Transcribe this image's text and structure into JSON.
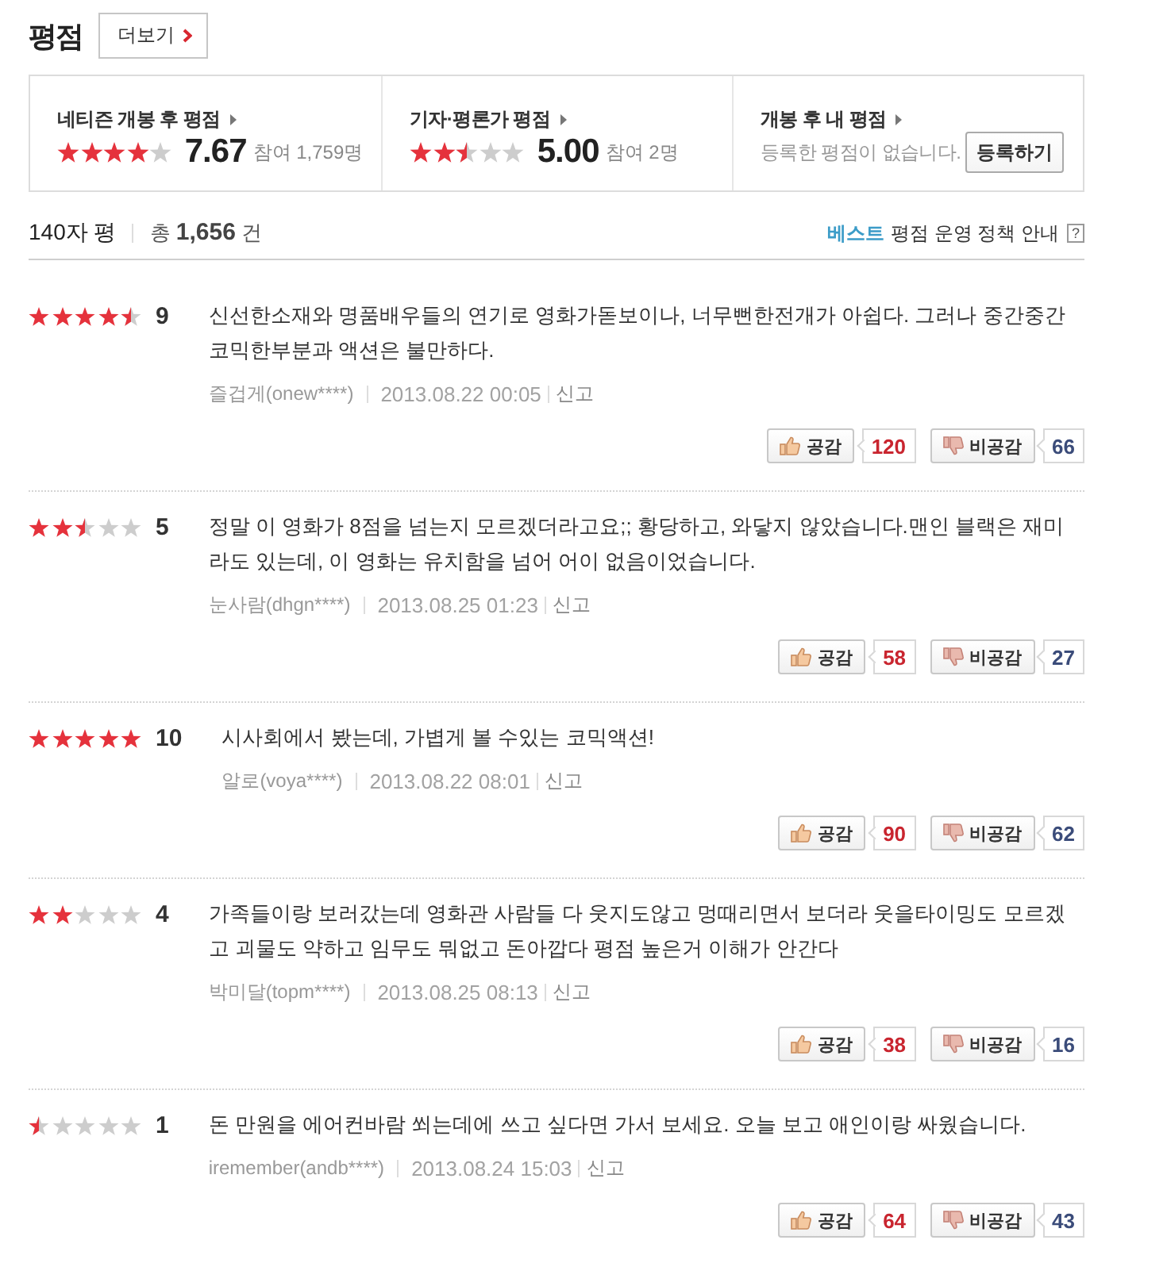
{
  "header": {
    "title": "평점",
    "more_button": "더보기"
  },
  "summary": [
    {
      "kind": "score",
      "label": "네티즌 개봉 후 평점",
      "stars": 4,
      "score": "7.67",
      "participants": "참여 1,759명"
    },
    {
      "kind": "score",
      "label": "기자·평론가 평점",
      "stars": 2.5,
      "score": "5.00",
      "participants": "참여 2명"
    },
    {
      "kind": "empty",
      "label": "개봉 후 내 평점",
      "message": "등록한 평점이 없습니다.",
      "button": "등록하기"
    }
  ],
  "list_header": {
    "title": "140자 평",
    "total": "총 **1,656** 건",
    "best_link": "베스트",
    "policy_link": "평점 운영 정책 안내",
    "help": "?"
  },
  "reviews": [
    {
      "stars": 4.5,
      "score": "9",
      "text": "신선한소재와 명품배우들의 연기로 영화가돋보이나, 너무뻔한전개가 아쉽다. 그러나 중간중간코믹한부분과 액션은 불만하다.",
      "author": "즐겁게(onew****)",
      "date": "2013.08.22 00:05",
      "report": "신고",
      "like_label": "공감",
      "likes": "120",
      "dislike_label": "비공감",
      "dislikes": "66"
    },
    {
      "stars": 2.5,
      "score": "5",
      "text": "정말 이 영화가 8점을 넘는지 모르겠더라고요;; 황당하고, 와닿지 않았습니다.맨인 블랙은 재미라도 있는데, 이 영화는 유치함을 넘어 어이 없음이었습니다.",
      "author": "눈사람(dhgn****)",
      "date": "2013.08.25 01:23",
      "report": "신고",
      "like_label": "공감",
      "likes": "58",
      "dislike_label": "비공감",
      "dislikes": "27"
    },
    {
      "stars": 5,
      "score": "10",
      "text": "시사회에서 봤는데, 가볍게 볼 수있는 코믹액션!",
      "author": "알로(voya****)",
      "date": "2013.08.22 08:01",
      "report": "신고",
      "like_label": "공감",
      "likes": "90",
      "dislike_label": "비공감",
      "dislikes": "62"
    },
    {
      "stars": 2,
      "score": "4",
      "text": "가족들이랑 보러갔는데 영화관 사람들 다 웃지도않고 멍때리면서 보더라 웃을타이밍도 모르겠고 괴물도 약하고 임무도 뭐없고 돈아깝다 평점 높은거 이해가 안간다",
      "author": "박미달(topm****)",
      "date": "2013.08.25 08:13",
      "report": "신고",
      "like_label": "공감",
      "likes": "38",
      "dislike_label": "비공감",
      "dislikes": "16"
    },
    {
      "stars": 0.5,
      "score": "1",
      "text": "돈 만원을 에어컨바람 쐬는데에 쓰고 싶다면 가서 보세요. 오늘 보고 애인이랑 싸웠습니다.",
      "author": "iremember(andb****)",
      "date": "2013.08.24 15:03",
      "report": "신고",
      "like_label": "공감",
      "likes": "64",
      "dislike_label": "비공감",
      "dislikes": "43"
    }
  ]
}
